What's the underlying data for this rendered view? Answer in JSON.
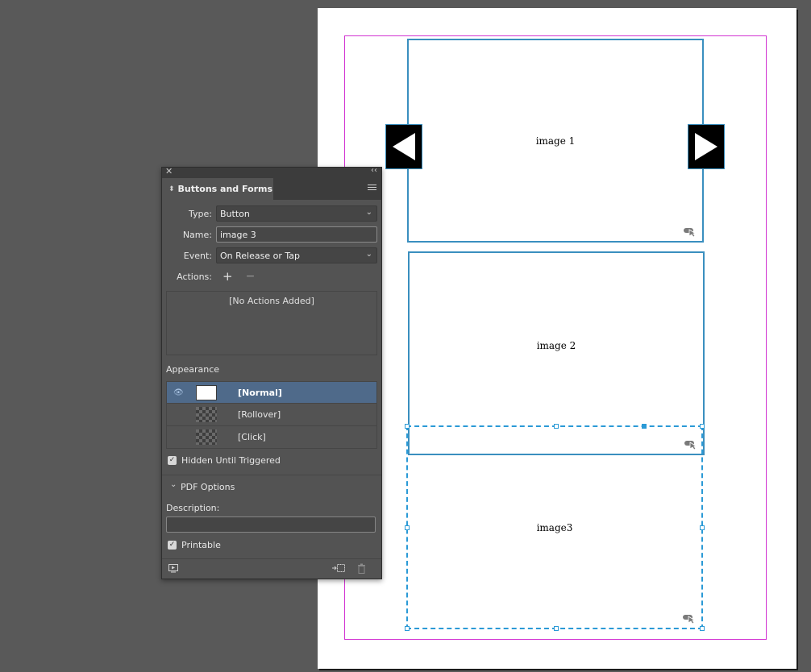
{
  "document": {
    "frames": [
      {
        "caption": "image 1"
      },
      {
        "caption": "image 2"
      },
      {
        "caption": "image3"
      }
    ]
  },
  "panel": {
    "title": "Buttons and Forms",
    "type_label": "Type:",
    "type_value": "Button",
    "name_label": "Name:",
    "name_value": "image 3",
    "event_label": "Event:",
    "event_value": "On Release or Tap",
    "actions_label": "Actions:",
    "actions_empty": "[No Actions Added]",
    "appearance_label": "Appearance",
    "states": [
      {
        "name": "[Normal]"
      },
      {
        "name": "[Rollover]"
      },
      {
        "name": "[Click]"
      }
    ],
    "hidden_until_triggered": "Hidden Until Triggered",
    "pdf_options": "PDF Options",
    "description_label": "Description:",
    "printable": "Printable"
  }
}
